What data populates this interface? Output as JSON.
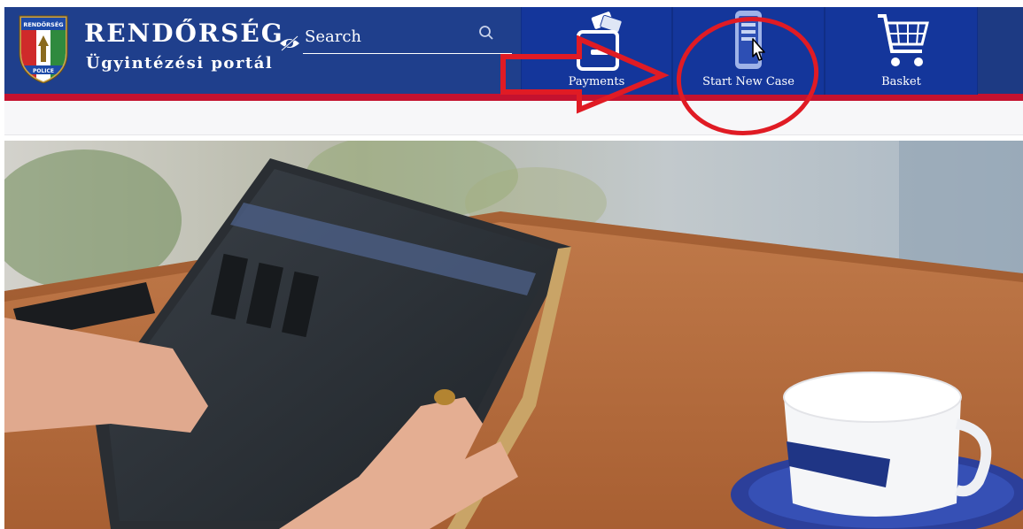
{
  "header": {
    "brand_title": "RENDŐRSÉG",
    "brand_subtitle": "Ügyintézési portál",
    "logo_text_top": "RENDŐRSÉG",
    "logo_text_bottom": "POLICE",
    "colors": {
      "header_bg": "#1f3f8c",
      "stripe": "#c4122f",
      "tile_bg": "#14369b",
      "annotation_red": "#e01b24"
    }
  },
  "search": {
    "placeholder": "Search",
    "value": ""
  },
  "nav": [
    {
      "label": "Payments",
      "icon": "wallet-icon"
    },
    {
      "label": "Start New Case",
      "icon": "new-case-form-icon"
    },
    {
      "label": "Basket",
      "icon": "basket-icon"
    }
  ],
  "hero": {
    "description_icon": "hero-photo"
  }
}
